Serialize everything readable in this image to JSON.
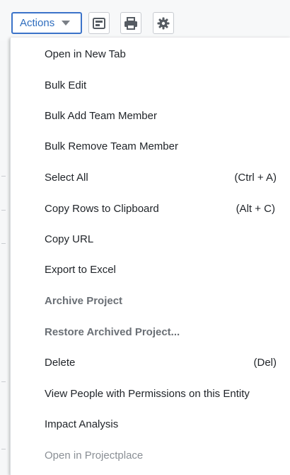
{
  "toolbar": {
    "actions_label": "Actions",
    "icons": [
      "layout-icon",
      "print-icon",
      "gear-icon"
    ]
  },
  "menu": {
    "items": [
      {
        "label": "Open in New Tab",
        "shortcut": "",
        "state": "enabled"
      },
      {
        "label": "Bulk Edit",
        "shortcut": "",
        "state": "enabled"
      },
      {
        "label": "Bulk Add Team Member",
        "shortcut": "",
        "state": "enabled"
      },
      {
        "label": "Bulk Remove Team Member",
        "shortcut": "",
        "state": "enabled"
      },
      {
        "label": "Select All",
        "shortcut": "(Ctrl + A)",
        "state": "enabled"
      },
      {
        "label": "Copy Rows to Clipboard",
        "shortcut": "(Alt + C)",
        "state": "enabled"
      },
      {
        "label": "Copy URL",
        "shortcut": "",
        "state": "enabled"
      },
      {
        "label": "Export to Excel",
        "shortcut": "",
        "state": "enabled"
      },
      {
        "label": "Archive Project",
        "shortcut": "",
        "state": "disabled"
      },
      {
        "label": "Restore Archived Project...",
        "shortcut": "",
        "state": "disabled"
      },
      {
        "label": "Delete",
        "shortcut": "(Del)",
        "state": "enabled"
      },
      {
        "label": "View People with Permissions on this Entity",
        "shortcut": "",
        "state": "enabled"
      },
      {
        "label": "Impact Analysis",
        "shortcut": "",
        "state": "enabled"
      },
      {
        "label": "Open in Projectplace",
        "shortcut": "",
        "state": "disabled"
      }
    ]
  },
  "colors": {
    "accent": "#3b73c9",
    "text": "#1f2328",
    "disabled_text": "#6d7278"
  }
}
